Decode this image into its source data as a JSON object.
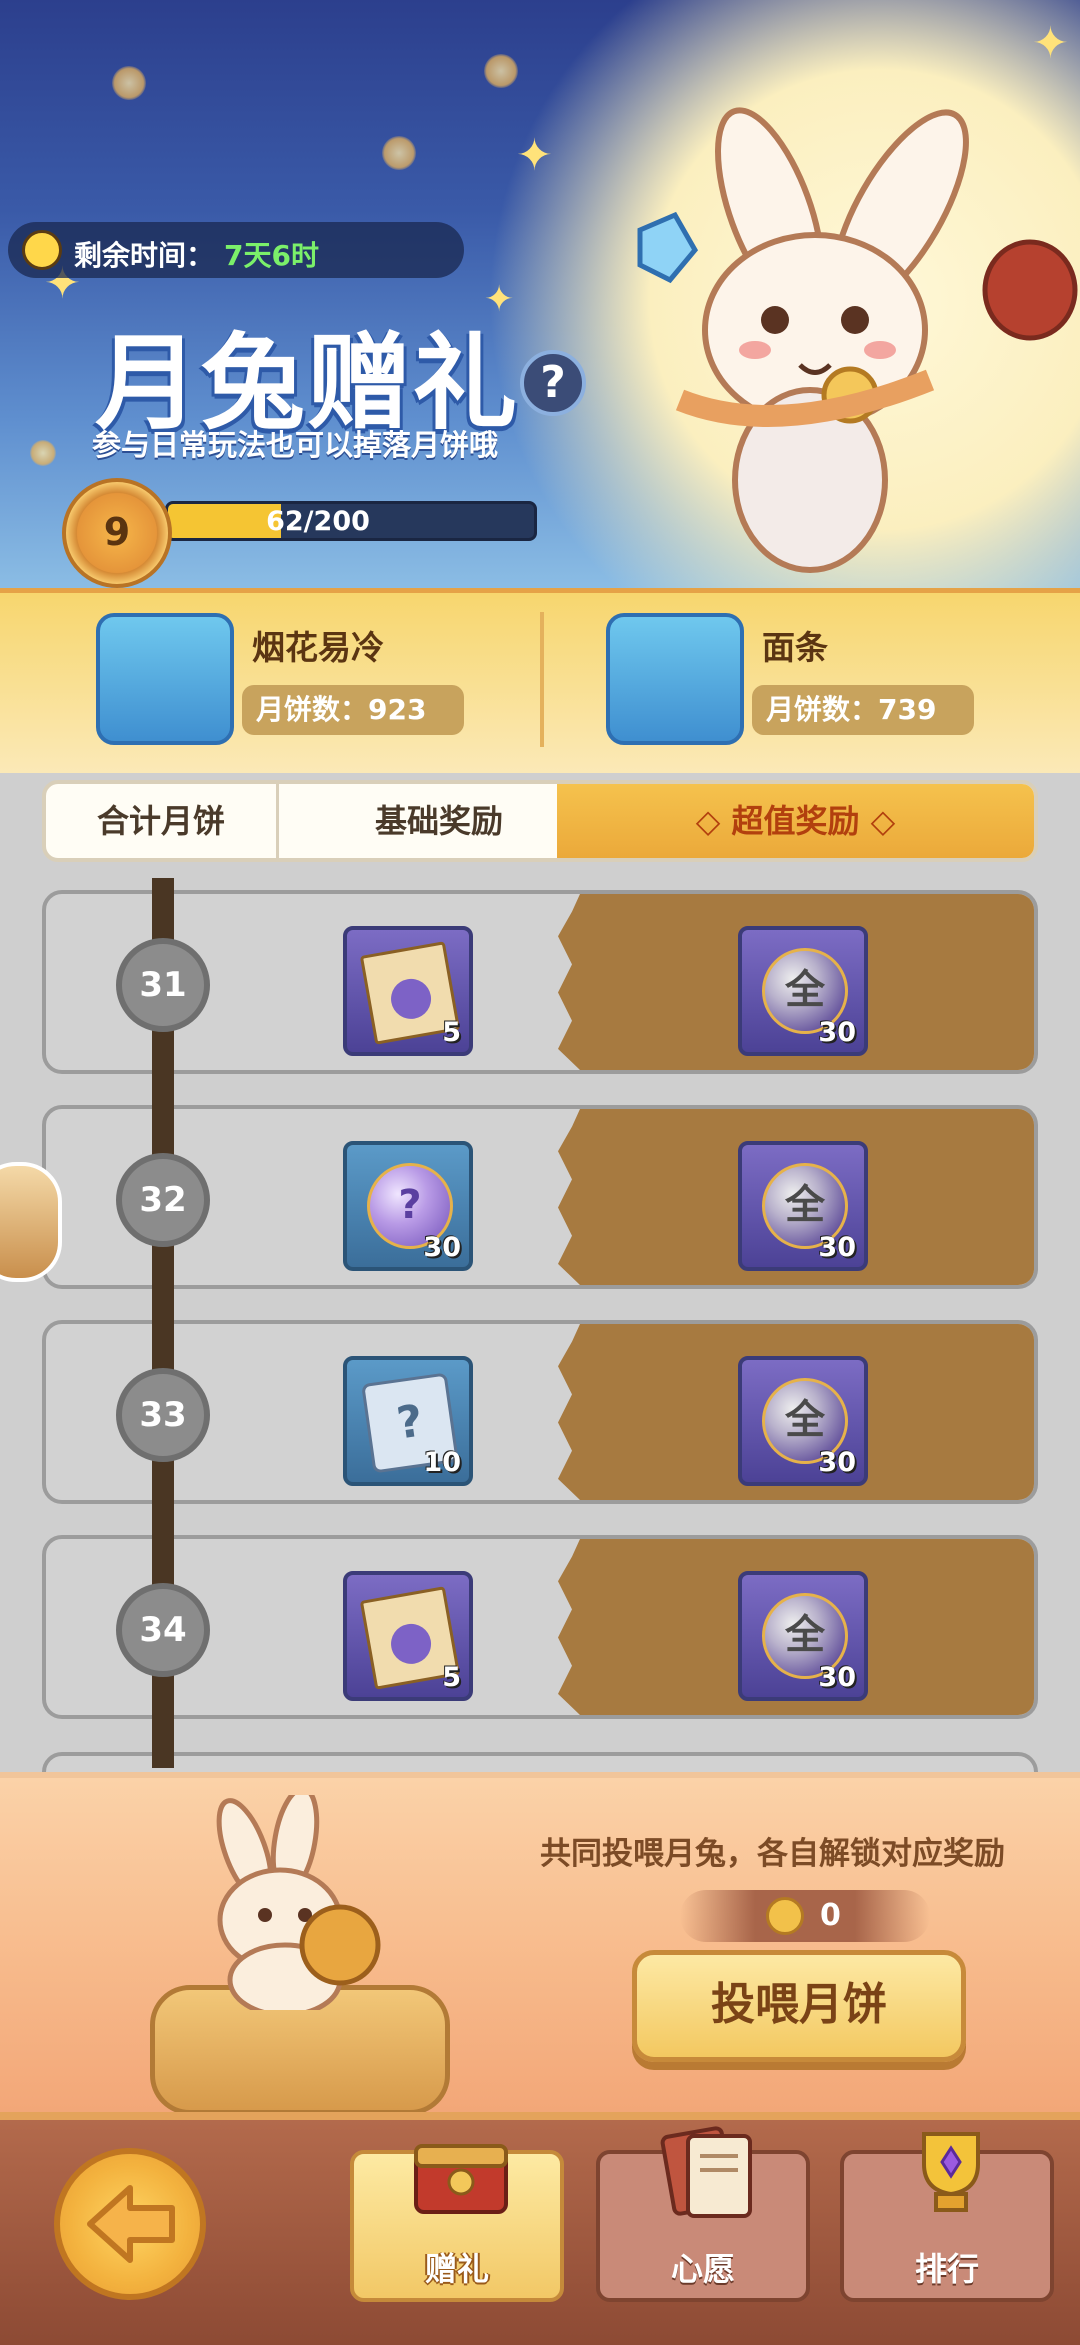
{
  "header": {
    "timer_label": "剩余时间：",
    "timer_value": "7天6时",
    "title": "月兔赠礼",
    "subtitle": "参与日常玩法也可以掉落月饼哦",
    "help_symbol": "?",
    "level": "9",
    "progress_text": "62/200",
    "progress_fraction": 0.31
  },
  "leaders": [
    {
      "name": "烟花易冷",
      "score": "月饼数：923"
    },
    {
      "name": "面条",
      "score": "月饼数：739"
    }
  ],
  "tabs": {
    "total": "合计月饼",
    "basic": "基础奖励",
    "premium": "◇ 超值奖励 ◇"
  },
  "rows": [
    {
      "level": "31",
      "left_item": "integral-book-icon",
      "left_qty": "5",
      "right_item": "all-orb-icon",
      "right_qty": "30",
      "orb_text": "全"
    },
    {
      "level": "32",
      "left_item": "mystery-orb-icon",
      "left_qty": "30",
      "right_item": "all-orb-icon",
      "right_qty": "30",
      "orb_text": "全",
      "mystery_text": "?"
    },
    {
      "level": "33",
      "left_item": "mystery-scroll-icon",
      "left_qty": "10",
      "right_item": "all-orb-icon",
      "right_qty": "30",
      "orb_text": "全",
      "mystery_text": "?"
    },
    {
      "level": "34",
      "left_item": "integral-book-icon",
      "left_qty": "5",
      "right_item": "all-orb-icon",
      "right_qty": "30",
      "orb_text": "全"
    }
  ],
  "feed": {
    "description": "共同投喂月兔，各自解锁对应奖励",
    "coin_count": "0",
    "button_label": "投喂月饼"
  },
  "nav": {
    "gift": "赠礼",
    "wish": "心愿",
    "rank": "排行"
  },
  "colors": {
    "accent_orange": "#eba93a",
    "premium_tab_text": "#b2400e",
    "timer_green": "#7bf06a"
  }
}
